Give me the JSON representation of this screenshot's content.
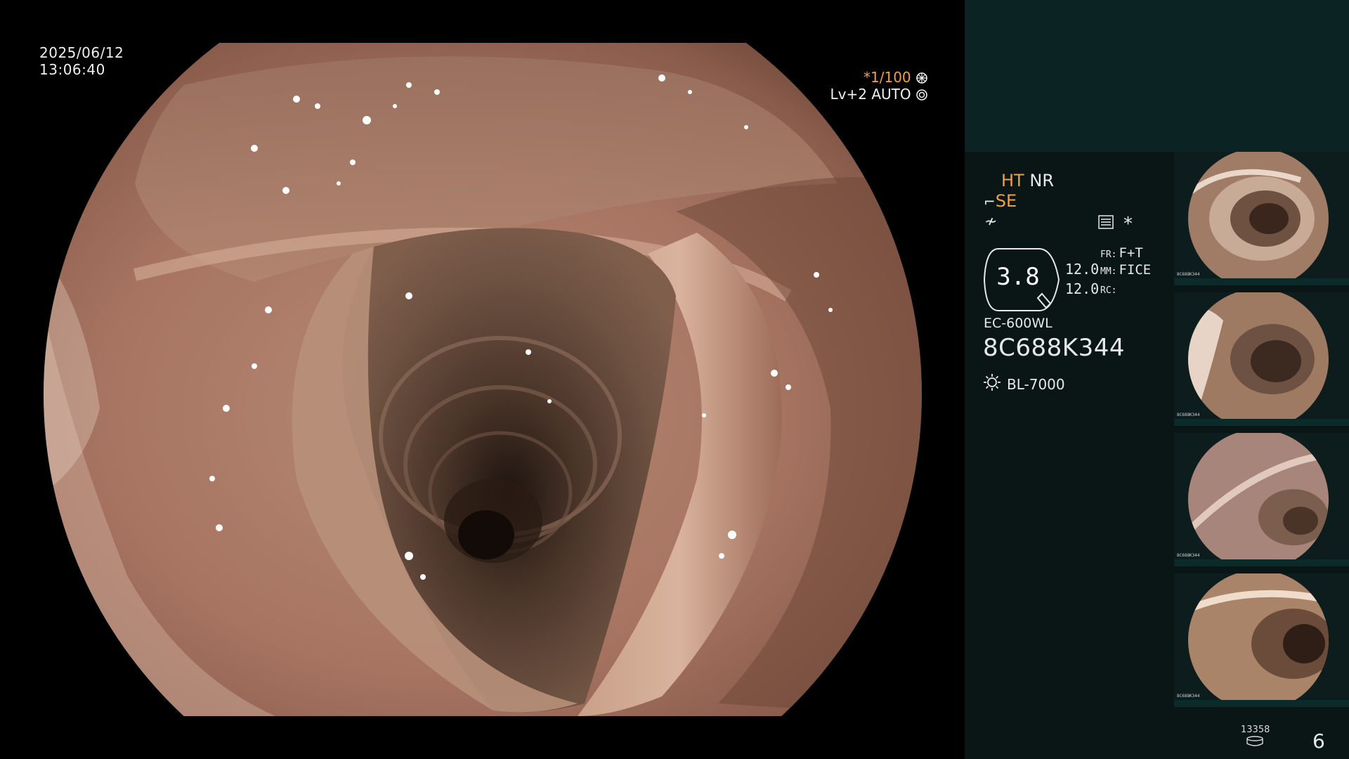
{
  "overlay": {
    "date": "2025/06/12",
    "time": "13:06:40",
    "shutter_marker": "*1/100",
    "shutter_icon": "aperture-icon",
    "level": "Lv+2",
    "exposure_mode": "AUTO",
    "exposure_icon": "iris-icon"
  },
  "info_panel": {
    "ht_label": "HT",
    "nr_label": "NR",
    "se_label": "SE",
    "se_prefix_icon": "enhance-icon",
    "wave_icon": "wave-icon",
    "grid_icon": "settings-grid-icon",
    "star": "*",
    "magnification": "3.8",
    "value_1": "12.0",
    "value_2": "12.0",
    "fr_key": "FR:",
    "fr_value": "F+T",
    "mm_key": "MM:",
    "mm_value": "FICE",
    "rc_key": "RC:",
    "rc_value": "",
    "scope_model": "EC-600WL",
    "scope_serial": "8C688K344",
    "light_icon": "light-source-icon",
    "light_source": "BL-7000",
    "capture_count": "13358",
    "storage_icon": "disk-icon",
    "page_number": "6"
  },
  "thumbnails": [
    {
      "id": "capture-1",
      "caption": "8C688K344"
    },
    {
      "id": "capture-2",
      "caption": "8C688K344"
    },
    {
      "id": "capture-3",
      "caption": "8C688K344"
    },
    {
      "id": "capture-4",
      "caption": "8C688K344"
    }
  ],
  "colors": {
    "accent_orange": "#f0a23b",
    "panel_bg": "#0a1616",
    "panel_top_bg": "#0c2323"
  }
}
